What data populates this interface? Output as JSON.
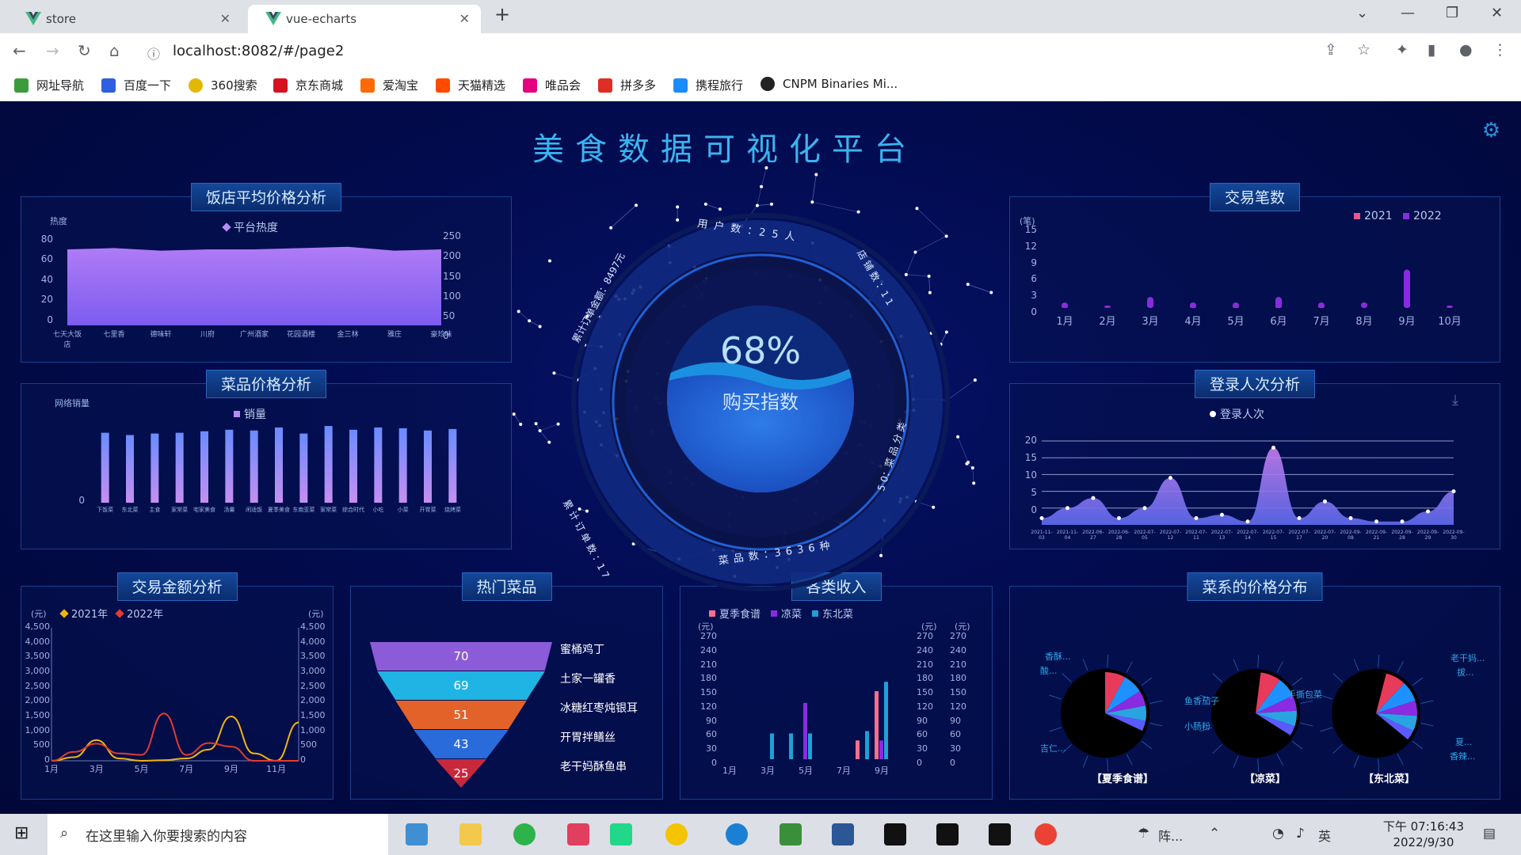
{
  "browser": {
    "tabs": [
      {
        "title": "store"
      },
      {
        "title": "vue-echarts"
      }
    ],
    "url": "localhost:8082/#/page2",
    "bookmarks": [
      "网址导航",
      "百度一下",
      "360搜索",
      "京东商城",
      "爱淘宝",
      "天猫精选",
      "唯品会",
      "拼多多",
      "携程旅行",
      "CNPM Binaries Mi..."
    ]
  },
  "page": {
    "title": "美食数据可视化平台"
  },
  "center": {
    "percent": "68%",
    "label": "购买指数",
    "ring_top": "用 户 数 ：2 5 人",
    "ring_left_top": "累计订单金额：8497元",
    "ring_right": "店 铺 数 ：1 1",
    "ring_right2": "5 0：菜 品 分 类",
    "ring_left_bottom": "累 计 订 单 数 ：1 7",
    "ring_bottom": "菜 品 数 ：3 6 3 6 种"
  },
  "panels": {
    "avgprice": {
      "title": "饭店平均价格分析",
      "legend": "平台热度",
      "ylabel": "热度",
      "yticks": [
        "80",
        "60",
        "40",
        "20",
        "0"
      ],
      "y2ticks": [
        "250",
        "200",
        "150",
        "100",
        "50",
        "0"
      ],
      "xticks": [
        "七天大饭店",
        "七里香",
        "德味轩",
        "川府",
        "广州酒家",
        "花园酒楼",
        "金三林",
        "雅庄",
        "豪珍味"
      ]
    },
    "dishprice": {
      "title": "菜品价格分析",
      "legend": "销量",
      "ylabel": "网络销量",
      "yticks": [
        "0"
      ],
      "xticks": [
        "下饭菜",
        "东北菜",
        "主食",
        "家常菜",
        "宅家美食",
        "汤羹",
        "闲适饭",
        "夏季美食",
        "东南亚菜",
        "家常菜",
        "综合时代",
        "小吃",
        "小菜",
        "开胃菜",
        "烧烤菜"
      ]
    },
    "trades": {
      "title": "交易笔数",
      "legend": [
        "2021",
        "2022"
      ],
      "ylabel": "(笔)",
      "yticks": [
        "15",
        "12",
        "9",
        "6",
        "3",
        "0"
      ],
      "xticks": [
        "1月",
        "2月",
        "3月",
        "4月",
        "5月",
        "6月",
        "7月",
        "8月",
        "9月",
        "10月"
      ]
    },
    "logins": {
      "title": "登录人次分析",
      "legend": "登录人次",
      "yticks": [
        "20",
        "15",
        "10",
        "5",
        "0"
      ],
      "xticks": [
        "2021-11-03",
        "2021-11-04",
        "2022-06-27",
        "2022-06-28",
        "2022-07-05",
        "2022-07-12",
        "2022-07-11",
        "2022-07-13",
        "2022-07-14",
        "2022-07-15",
        "2022-07-17",
        "2022-07-20",
        "2022-09-08",
        "2022-09-21",
        "2022-09-28",
        "2022-09-29",
        "2022-09-30"
      ]
    },
    "amount": {
      "title": "交易金额分析",
      "legend": [
        "2021年",
        "2022年"
      ],
      "unit": "(元)",
      "yticks": [
        "4,500",
        "4,000",
        "3,500",
        "3,000",
        "2,500",
        "2,000",
        "1,500",
        "1,000",
        "500",
        "0"
      ],
      "xticks": [
        "1月",
        "3月",
        "5月",
        "7月",
        "9月",
        "11月"
      ]
    },
    "hot": {
      "title": "热门菜品",
      "items": [
        {
          "name": "蜜桶鸡丁",
          "value": "70"
        },
        {
          "name": "土家一罐香",
          "value": "69"
        },
        {
          "name": "冰糖红枣炖银耳",
          "value": "51"
        },
        {
          "name": "开胃拌鳝丝",
          "value": "43"
        },
        {
          "name": "老干妈酥鱼串",
          "value": "25"
        }
      ]
    },
    "income": {
      "title": "各类收入",
      "legend": [
        "夏季食谱",
        "凉菜",
        "东北菜"
      ],
      "unit": "(元)",
      "yticks": [
        "270",
        "240",
        "210",
        "180",
        "150",
        "120",
        "90",
        "60",
        "30",
        "0"
      ],
      "xticks": [
        "1月",
        "3月",
        "5月",
        "7月",
        "9月"
      ]
    },
    "pricedist": {
      "title": "菜系的价格分布",
      "pies": [
        "【夏季食谱】",
        "【凉菜】",
        "【东北菜】"
      ],
      "labels": [
        "香酥...",
        "酸...",
        "吉仁...",
        "夏...",
        "老干妈...",
        "拔...",
        "香辣...",
        "手撕包菜",
        "小肠粉",
        "鱼香茄子"
      ]
    }
  },
  "chart_data": [
    {
      "type": "area",
      "title": "饭店平均价格分析",
      "categories": [
        "七天大饭店",
        "七里香",
        "德味轩",
        "川府",
        "广州酒家",
        "花园酒楼",
        "金三林",
        "雅庄",
        "豪珍味"
      ],
      "series": [
        {
          "name": "平台热度",
          "values": [
            60,
            61,
            59,
            60,
            60,
            61,
            62,
            59,
            60
          ]
        }
      ],
      "ylim": [
        0,
        80
      ]
    },
    {
      "type": "bar",
      "title": "菜品价格分析",
      "categories": [
        "下饭菜",
        "东北菜",
        "主食",
        "家常菜",
        "宅家美食",
        "汤羹",
        "闲适饭",
        "夏季美食",
        "东南亚菜",
        "家常菜",
        "综合时代",
        "小吃",
        "小菜",
        "开胃菜",
        "烧烤菜"
      ],
      "series": [
        {
          "name": "销量",
          "values": [
            93,
            90,
            92,
            93,
            95,
            97,
            96,
            100,
            92,
            102,
            97,
            100,
            99,
            96,
            98
          ]
        }
      ],
      "ylim": [
        0,
        120
      ]
    },
    {
      "type": "bar",
      "title": "交易笔数",
      "categories": [
        "1月",
        "2月",
        "3月",
        "4月",
        "5月",
        "6月",
        "7月",
        "8月",
        "9月",
        "10月"
      ],
      "series": [
        {
          "name": "2021",
          "values": [
            0,
            0,
            1,
            0,
            0,
            0,
            0,
            1,
            1,
            0
          ]
        },
        {
          "name": "2022",
          "values": [
            1,
            0,
            2,
            1,
            1,
            2,
            1,
            1,
            7,
            0
          ]
        }
      ],
      "ylim": [
        0,
        15
      ]
    },
    {
      "type": "area",
      "title": "登录人次分析",
      "categories": [
        "2021-11-03",
        "2021-11-04",
        "2022-06-27",
        "2022-06-28",
        "2022-07-05",
        "2022-07-12",
        "2022-07-11",
        "2022-07-13",
        "2022-07-14",
        "2022-07-15",
        "2022-07-17",
        "2022-07-20",
        "2022-09-08",
        "2022-09-21",
        "2022-09-28",
        "2022-09-29",
        "2022-09-30"
      ],
      "series": [
        {
          "name": "登录人次",
          "values": [
            2,
            5,
            8,
            2,
            5,
            14,
            2,
            3,
            1,
            23,
            2,
            7,
            2,
            1,
            1,
            4,
            10
          ]
        }
      ],
      "ylim": [
        0,
        25
      ]
    },
    {
      "type": "line",
      "title": "交易金额分析",
      "categories": [
        "1月",
        "2月",
        "3月",
        "4月",
        "5月",
        "6月",
        "7月",
        "8月",
        "9月",
        "10月",
        "11月",
        "12月"
      ],
      "series": [
        {
          "name": "2021年",
          "values": [
            0,
            120,
            700,
            80,
            0,
            20,
            80,
            380,
            1500,
            250,
            0,
            1300
          ]
        },
        {
          "name": "2022年",
          "values": [
            0,
            300,
            580,
            250,
            200,
            1600,
            200,
            600,
            480,
            0,
            0,
            0
          ]
        }
      ],
      "ylim": [
        0,
        4500
      ]
    },
    {
      "type": "bar",
      "title": "各类收入",
      "categories": [
        "1月",
        "2月",
        "3月",
        "4月",
        "5月",
        "6月",
        "7月",
        "8月",
        "9月",
        "10月"
      ],
      "series": [
        {
          "name": "夏季食谱",
          "values": [
            0,
            0,
            0,
            0,
            0,
            0,
            0,
            40,
            145,
            0
          ]
        },
        {
          "name": "凉菜",
          "values": [
            0,
            0,
            0,
            0,
            120,
            0,
            0,
            0,
            40,
            0
          ]
        },
        {
          "name": "东北菜",
          "values": [
            0,
            0,
            55,
            55,
            55,
            0,
            0,
            60,
            165,
            0
          ]
        }
      ],
      "ylim": [
        0,
        270
      ]
    }
  ],
  "taskbar": {
    "search": "在这里输入你要搜索的内容",
    "time": "下午 07:16:43",
    "date": "2022/9/30",
    "lang": "英",
    "tray": "阵..."
  }
}
